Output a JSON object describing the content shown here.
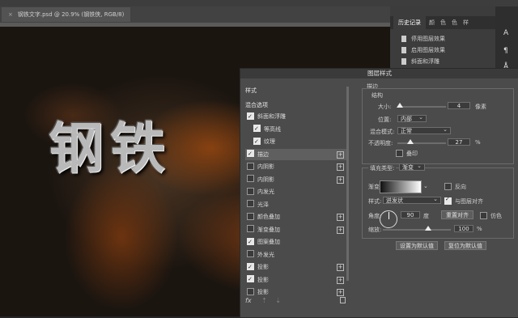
{
  "document": {
    "tab_label": "钢铁文字.psd @ 20.9% (钢铁侠, RGB/8)"
  },
  "canvas": {
    "text": "钢铁"
  },
  "history_panel": {
    "tabs": [
      "历史记录",
      "颜",
      "色",
      "色",
      "样"
    ],
    "items": [
      "停用图层效果",
      "启用图层效果",
      "斜面和浮雕"
    ]
  },
  "side_strip": {
    "glyphs": [
      "A",
      "¶",
      "Å"
    ]
  },
  "dialog": {
    "title": "图层样式",
    "list_header": "样式",
    "blend_options": "混合选项",
    "list_items": [
      {
        "label": "斜面和浮雕",
        "checked": true,
        "plus": false,
        "indent": 0
      },
      {
        "label": "等高线",
        "checked": true,
        "plus": false,
        "indent": 1
      },
      {
        "label": "纹理",
        "checked": true,
        "plus": false,
        "indent": 1
      },
      {
        "label": "描边",
        "checked": true,
        "plus": true,
        "indent": 0,
        "selected": true
      },
      {
        "label": "内阴影",
        "checked": false,
        "plus": true,
        "indent": 0
      },
      {
        "label": "内阴影",
        "checked": false,
        "plus": true,
        "indent": 0
      },
      {
        "label": "内发光",
        "checked": false,
        "plus": false,
        "indent": 0
      },
      {
        "label": "光泽",
        "checked": false,
        "plus": false,
        "indent": 0
      },
      {
        "label": "颜色叠加",
        "checked": false,
        "plus": true,
        "indent": 0
      },
      {
        "label": "渐变叠加",
        "checked": false,
        "plus": true,
        "indent": 0
      },
      {
        "label": "图案叠加",
        "checked": true,
        "plus": false,
        "indent": 0
      },
      {
        "label": "外发光",
        "checked": false,
        "plus": false,
        "indent": 0
      },
      {
        "label": "投影",
        "checked": true,
        "plus": true,
        "indent": 0
      },
      {
        "label": "投影",
        "checked": true,
        "plus": true,
        "indent": 0
      },
      {
        "label": "投影",
        "checked": false,
        "plus": true,
        "indent": 0
      }
    ],
    "footer": {
      "fx": "fx",
      "up": "⇡",
      "down": "⇣",
      "trash": "🗑"
    },
    "stroke": {
      "section_title": "描边",
      "structure_title": "结构",
      "size_label": "大小:",
      "size_value": "4",
      "size_unit": "像素",
      "size_fraction": 0.05,
      "position_label": "位置:",
      "position_value": "内部",
      "blend_label": "混合模式:",
      "blend_value": "正常",
      "opacity_label": "不透明度:",
      "opacity_value": "27",
      "opacity_unit": "%",
      "opacity_fraction": 0.27,
      "overprint_label": "叠印",
      "fill_type_label": "填充类型:",
      "fill_type_value": "渐变",
      "gradient_label": "渐变:",
      "reverse_label": "反向",
      "style_label": "样式:",
      "style_value": "迸发状",
      "align_label": "与图层对齐",
      "angle_label": "角度:",
      "angle_value": "90",
      "angle_unit": "度",
      "reset_align": "重置对齐",
      "dither_label": "仿色",
      "scale_label": "缩放:",
      "scale_value": "100",
      "scale_unit": "%",
      "scale_fraction": 0.67,
      "set_default": "设置为默认值",
      "reset_default": "复位为默认值"
    }
  }
}
